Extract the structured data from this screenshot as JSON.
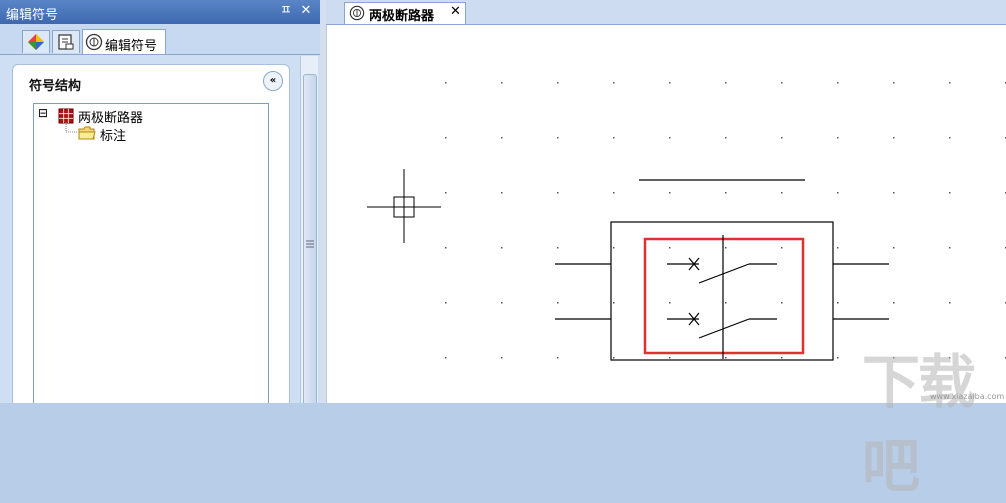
{
  "left_panel": {
    "title": "编辑符号",
    "pin_label": "ㅍ",
    "close_label": "✕",
    "tabs": [
      {
        "label": "",
        "icon": "color-palette-icon"
      },
      {
        "label": "",
        "icon": "page-icon"
      },
      {
        "label": "编辑符号",
        "icon": "edit-symbol-icon"
      }
    ],
    "section_title": "符号结构",
    "collapse_label": "«",
    "tree": {
      "expander": "⊟",
      "root_label": "两极断路器",
      "child_label": "标注"
    }
  },
  "document": {
    "tab_label": "两极断路器",
    "tab_close": "✕"
  },
  "watermark": {
    "text": "下载吧",
    "url": "www.xiazaiba.com"
  }
}
